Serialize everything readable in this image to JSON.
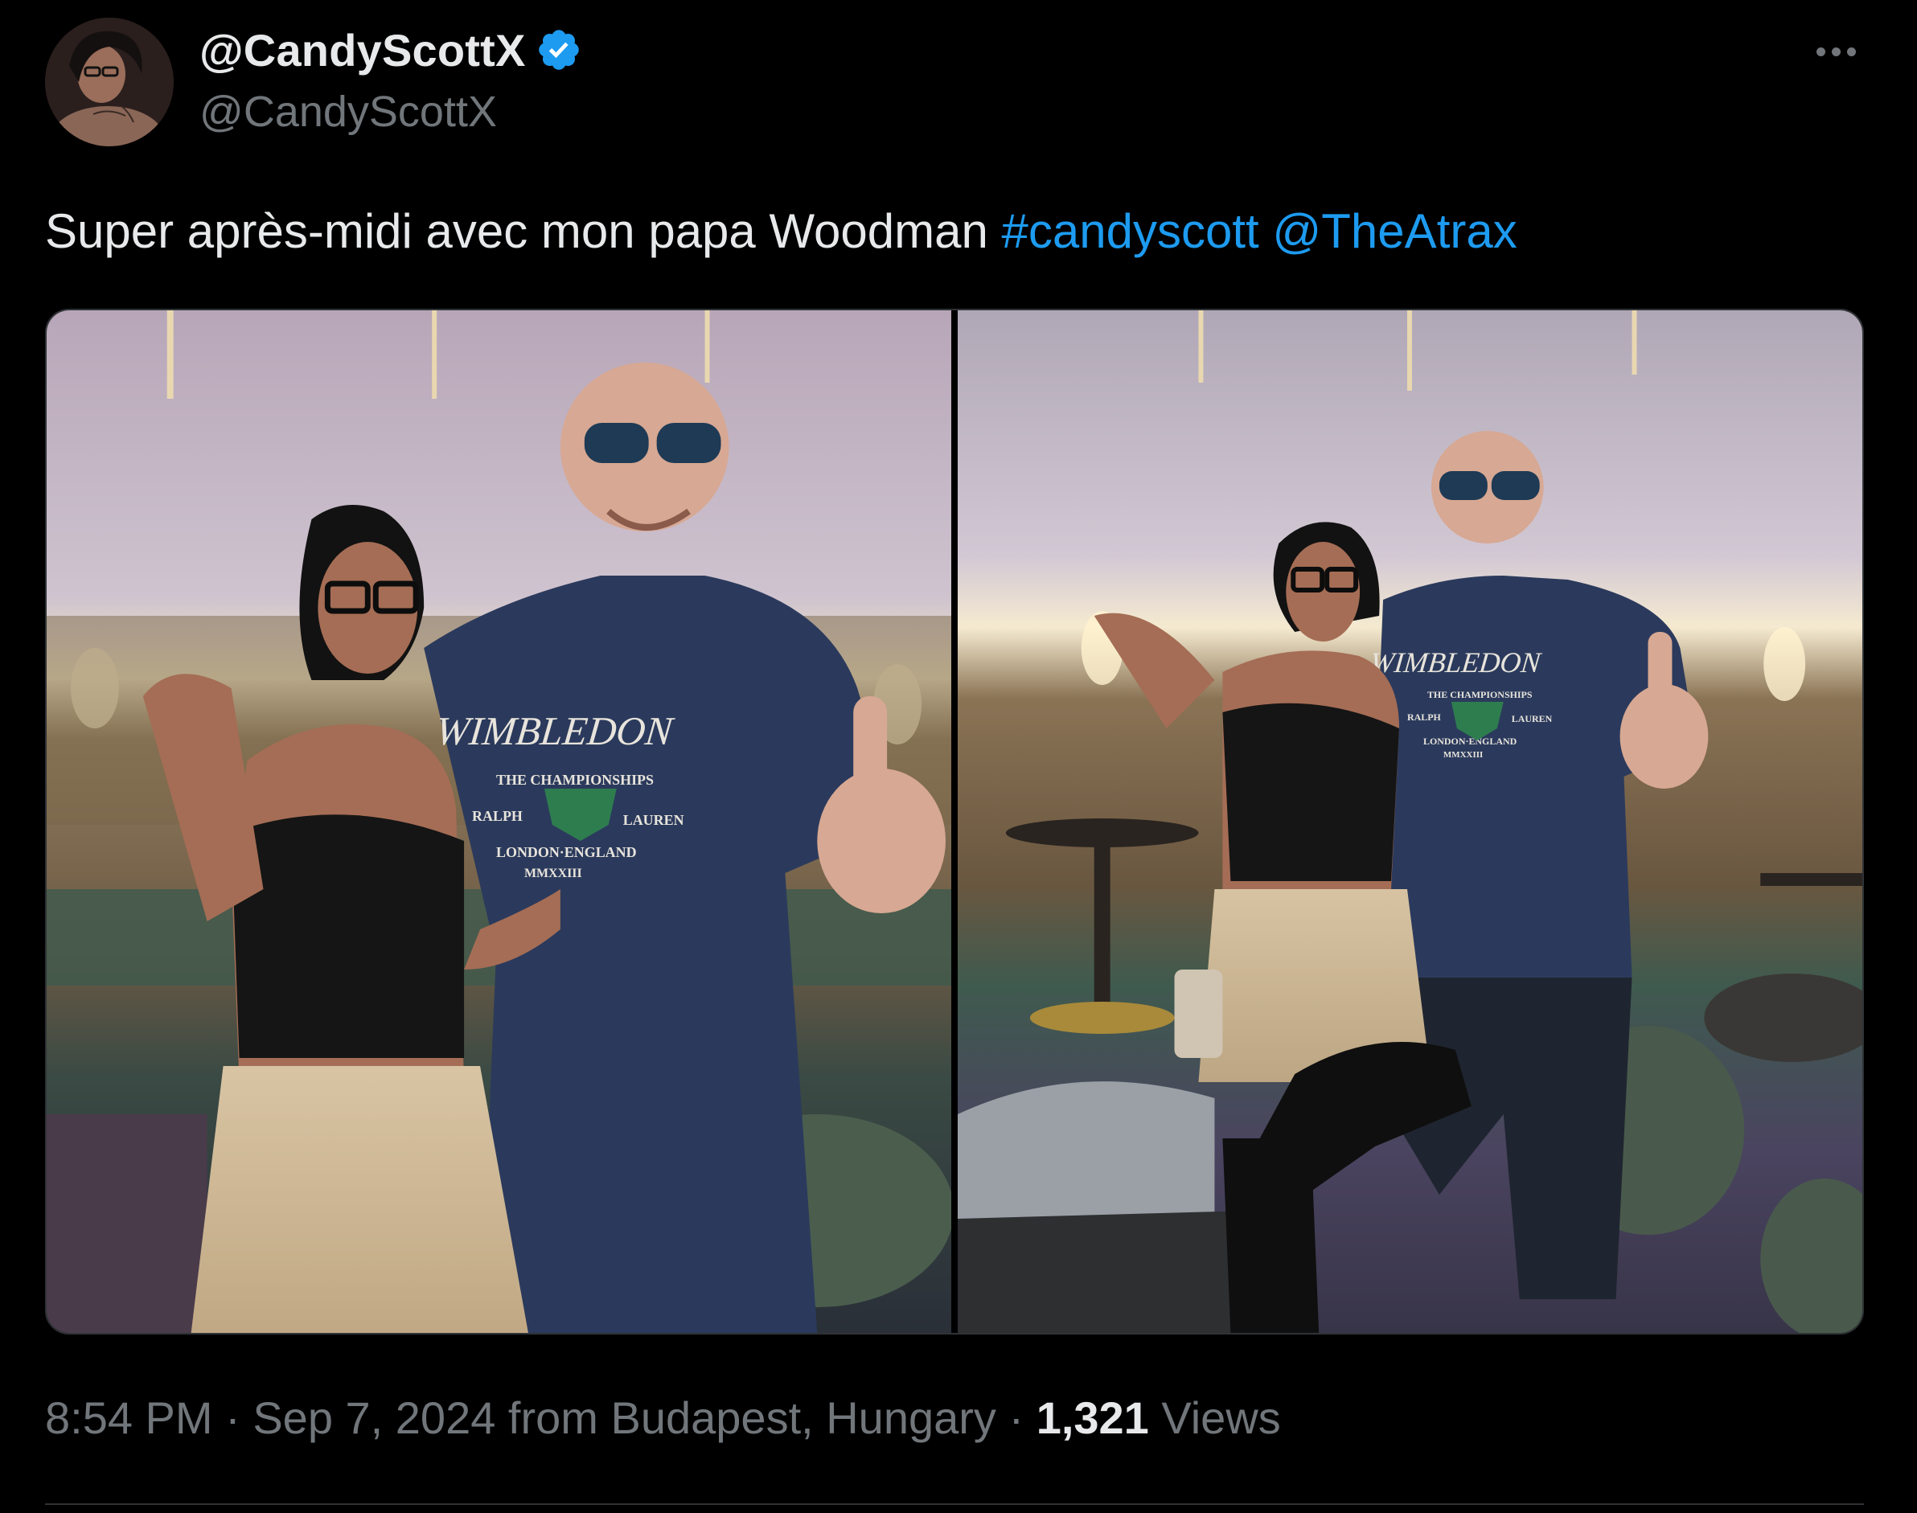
{
  "author": {
    "display_name": "@CandyScottX",
    "handle": "@CandyScottX",
    "verified": true,
    "avatar_icon": "profile-photo"
  },
  "more_icon": "ellipsis-icon",
  "tweet": {
    "text": "Super après-midi avec mon papa Woodman",
    "hashtag": "#candyscott",
    "mention": "@TheAtrax"
  },
  "media": {
    "count": 2,
    "photo1_shirt": {
      "line1": "WIMBLEDON",
      "line2": "THE CHAMPIONSHIPS",
      "left": "RALPH",
      "right": "LAUREN",
      "line3": "LONDON·ENGLAND",
      "line4": "MMXXIII"
    }
  },
  "footer": {
    "time": "8:54 PM",
    "sep1": " · ",
    "date": "Sep 7, 2024",
    "from_text": " from Budapest, Hungary",
    "sep2": " · ",
    "views_count": "1,321",
    "views_label": " Views"
  },
  "colors": {
    "background": "#000000",
    "text": "#e7e9ea",
    "secondary": "#71767b",
    "link": "#1d9bf0",
    "verified": "#1d9bf0",
    "divider": "#2f3336"
  }
}
